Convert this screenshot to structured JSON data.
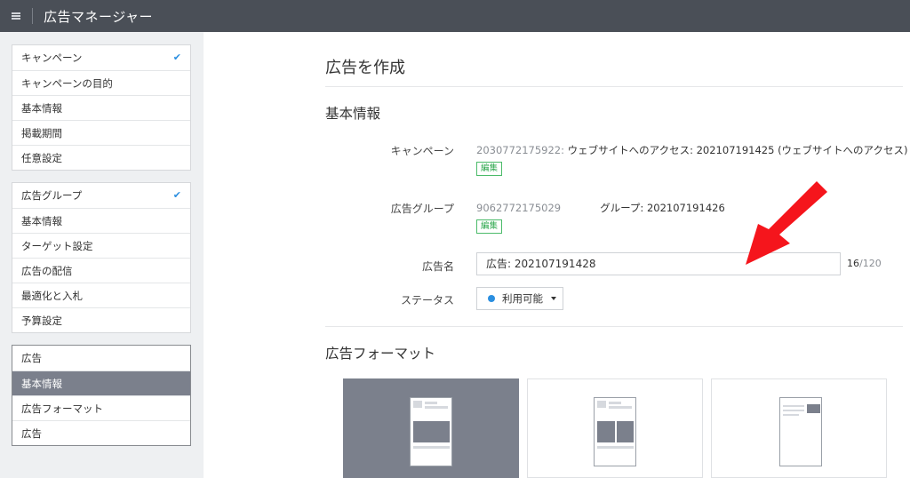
{
  "app": {
    "title": "広告マネージャー"
  },
  "sidebar": {
    "campaign_group": [
      {
        "label": "キャンペーン",
        "header": true,
        "checked": true
      },
      {
        "label": "キャンペーンの目的"
      },
      {
        "label": "基本情報"
      },
      {
        "label": "掲載期間"
      },
      {
        "label": "任意設定"
      }
    ],
    "adgroup_group": [
      {
        "label": "広告グループ",
        "header": true,
        "checked": true
      },
      {
        "label": "基本情報"
      },
      {
        "label": "ターゲット設定"
      },
      {
        "label": "広告の配信"
      },
      {
        "label": "最適化と入札"
      },
      {
        "label": "予算設定"
      }
    ],
    "ad_group": [
      {
        "label": "広告",
        "header": true
      },
      {
        "label": "基本情報",
        "active": true
      },
      {
        "label": "広告フォーマット"
      },
      {
        "label": "広告"
      }
    ]
  },
  "main": {
    "page_title": "広告を作成",
    "basic_section_title": "基本情報",
    "campaign": {
      "label": "キャンペーン",
      "id": "2030772175922:",
      "value": " ウェブサイトへのアクセス: 202107191425 (ウェブサイトへのアクセス)",
      "edit_label": "編集"
    },
    "adgroup": {
      "label": "広告グループ",
      "id": "9062772175029",
      "value": "グループ: 202107191426",
      "edit_label": "編集"
    },
    "ad_name": {
      "label": "広告名",
      "value": "広告: 202107191428",
      "count": "16",
      "max": "/120"
    },
    "status": {
      "label": "ステータス",
      "value": "利用可能"
    },
    "format_section_title": "広告フォーマット"
  },
  "colors": {
    "topbar": "#4a4f57",
    "sidebar_bg": "#eef0f2",
    "active_item": "#7b808c",
    "accent_blue": "#2b8fe0",
    "edit_green": "#2fa84f",
    "arrow_red": "#f5151c"
  },
  "icons": {
    "menu": "hamburger-icon",
    "check": "check-icon",
    "status_dot": "dot-icon",
    "dropdown": "caret-down-icon",
    "annotation": "red-arrow-icon"
  }
}
